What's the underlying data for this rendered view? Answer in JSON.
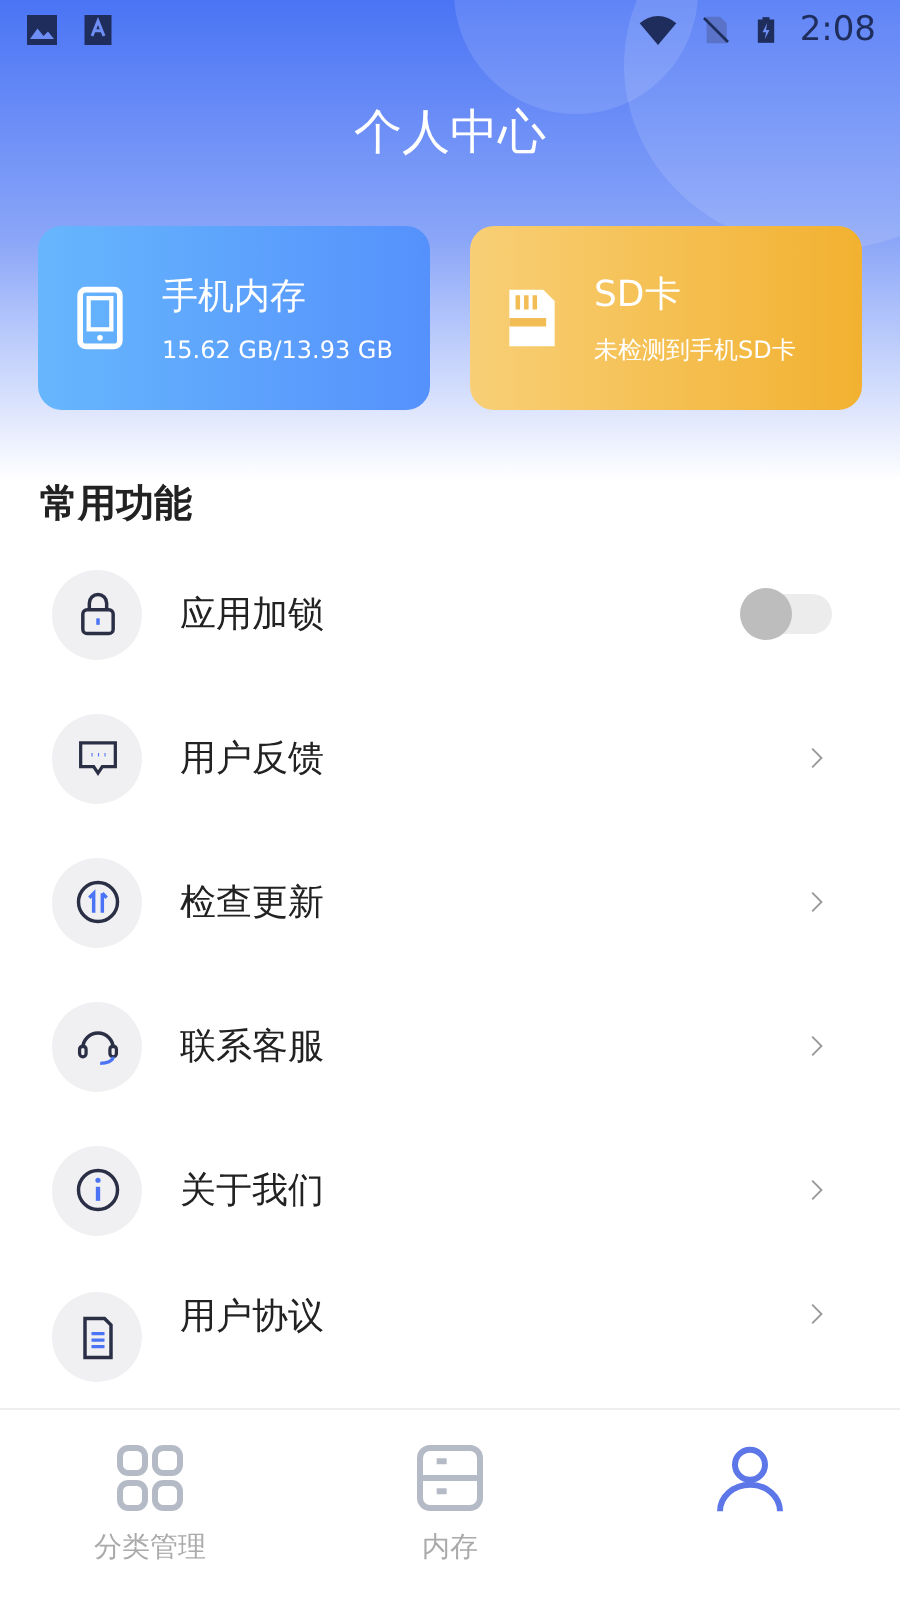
{
  "status_bar": {
    "time": "2:08"
  },
  "header": {
    "title": "个人中心"
  },
  "cards": [
    {
      "kind": "phone",
      "title": "手机内存",
      "subtitle": "15.62 GB/13.93 GB"
    },
    {
      "kind": "sd",
      "title": "SD卡",
      "subtitle": "未检测到手机SD卡"
    }
  ],
  "section": {
    "title": "常用功能"
  },
  "items": [
    {
      "kind": "toggle",
      "label": "应用加锁",
      "on": false
    },
    {
      "kind": "link",
      "label": "用户反馈"
    },
    {
      "kind": "link",
      "label": "检查更新"
    },
    {
      "kind": "link",
      "label": "联系客服"
    },
    {
      "kind": "link",
      "label": "关于我们"
    },
    {
      "kind": "link",
      "label": "用户协议"
    }
  ],
  "bottom_nav": [
    {
      "label": "分类管理",
      "selected": false
    },
    {
      "label": "内存",
      "selected": false
    },
    {
      "selected": true
    }
  ]
}
